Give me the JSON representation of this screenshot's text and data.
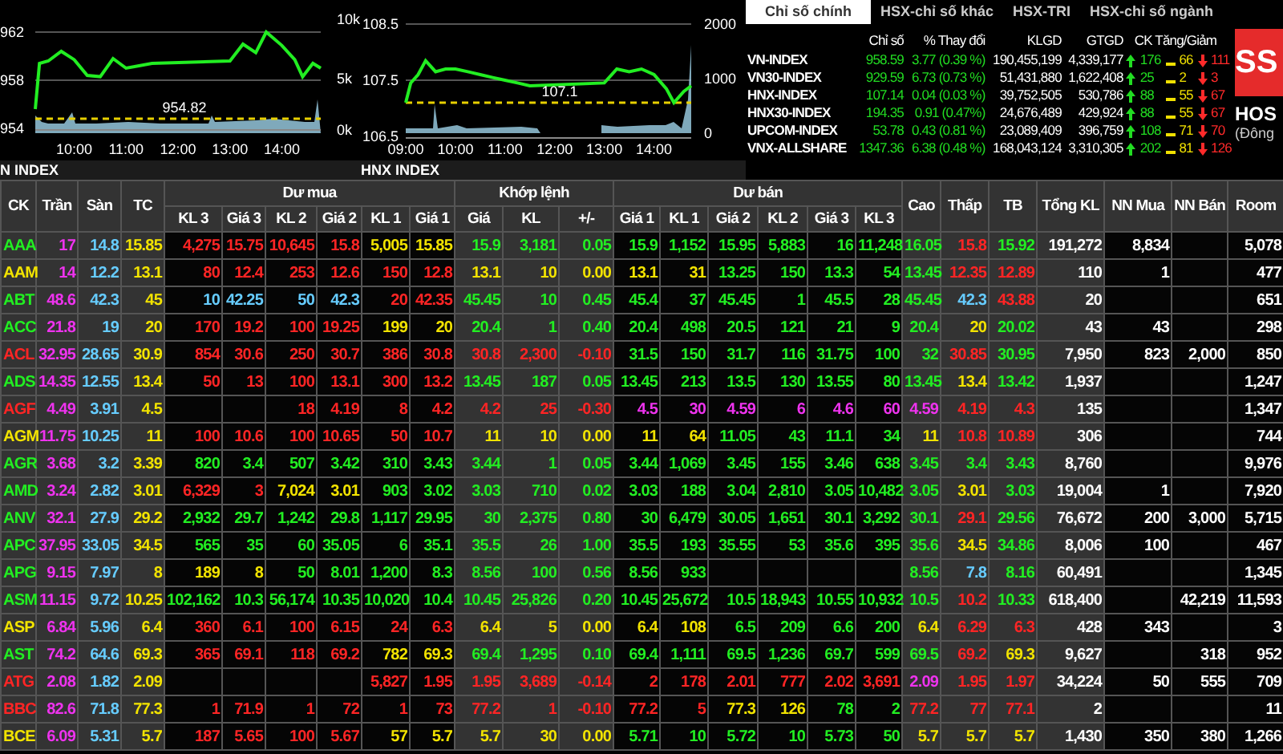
{
  "charts": [
    {
      "label": "N INDEX",
      "volume_ticks": [
        "10k",
        "5k",
        "0k"
      ],
      "reference": "954.82",
      "chart_data": {
        "type": "line",
        "x": [
          9.25,
          9.33,
          9.5,
          9.75,
          10,
          10.25,
          10.5,
          10.75,
          11,
          11.25,
          11.5,
          13,
          13.25,
          13.5,
          13.7,
          14,
          14.25,
          14.4,
          14.6,
          14.75
        ],
        "series": [
          {
            "color": "#22ee22",
            "values": [
              955.6,
              959.4,
              959.6,
              960.4,
              959.7,
              958.4,
              958.3,
              959.8,
              959.0,
              959.2,
              959.4,
              959.6,
              961.0,
              960.3,
              962.0,
              960.9,
              959.7,
              958.3,
              959.4,
              959.0
            ]
          }
        ],
        "xlim": [
          9.25,
          14.75
        ],
        "ylim": [
          954,
          962
        ],
        "xticks": [
          {
            "value": 10,
            "label": "10:00"
          },
          {
            "value": 11,
            "label": "11:00"
          },
          {
            "value": 12,
            "label": "12:00"
          },
          {
            "value": 13,
            "label": "13:00"
          },
          {
            "value": 14,
            "label": "14:00"
          }
        ],
        "yticks": [
          962,
          958,
          954
        ]
      }
    },
    {
      "label": "HNX INDEX",
      "volume_ticks": [
        "2000",
        "1000",
        "0"
      ],
      "reference": "107.1",
      "chart_data": {
        "type": "line",
        "x": [
          9,
          9.1,
          9.25,
          9.4,
          9.6,
          9.8,
          10,
          10.25,
          10.5,
          10.75,
          11,
          11.25,
          11.5,
          13,
          13.25,
          13.5,
          13.75,
          14,
          14.25,
          14.4,
          14.6,
          14.75
        ],
        "series": [
          {
            "color": "#22ee22",
            "values": [
              107.1,
              107.45,
              107.6,
              107.85,
              107.65,
              107.7,
              107.7,
              107.65,
              107.6,
              107.55,
              107.5,
              107.45,
              107.4,
              107.45,
              107.7,
              107.65,
              107.7,
              107.6,
              107.35,
              107.1,
              107.3,
              107.4
            ]
          }
        ],
        "xlim": [
          9,
          14.75
        ],
        "ylim": [
          106.5,
          108.5
        ],
        "xticks": [
          {
            "value": 9,
            "label": "09:00"
          },
          {
            "value": 10,
            "label": "10:00"
          },
          {
            "value": 11,
            "label": "11:00"
          },
          {
            "value": 12,
            "label": "12:00"
          },
          {
            "value": 13,
            "label": "13:00"
          },
          {
            "value": 14,
            "label": "14:00"
          }
        ],
        "yticks": [
          {
            "value": 108.5,
            "label": "108.5"
          },
          {
            "value": 107.5,
            "label": "107.5"
          },
          {
            "value": 106.5,
            "label": "106.5"
          }
        ]
      }
    }
  ],
  "index_panel": {
    "tabs": [
      {
        "label": "Chỉ số chính",
        "selected": true
      },
      {
        "label": "HSX-chỉ số khác",
        "selected": false
      },
      {
        "label": "HSX-TRI",
        "selected": false
      },
      {
        "label": "HSX-chỉ số ngành",
        "selected": false
      }
    ],
    "columns": [
      "Chỉ số",
      "% Thay đổi",
      "KLGD",
      "GTGD",
      "CK Tăng/Giảm"
    ],
    "rows": [
      {
        "name": "VN-INDEX",
        "value": "958.59",
        "change": "3.77 (0.39 %)",
        "klgd": "190,455,199",
        "gtgd": "4,339,177",
        "up": "176",
        "flat": "66",
        "down": "111"
      },
      {
        "name": "VN30-INDEX",
        "value": "929.59",
        "change": "6.73 (0.73 %)",
        "klgd": "51,431,880",
        "gtgd": "1,622,408",
        "up": "25",
        "flat": "2",
        "down": "3"
      },
      {
        "name": "HNX-INDEX",
        "value": "107.14",
        "change": "0.04 (0.03 %)",
        "klgd": "39,752,505",
        "gtgd": "530,786",
        "up": "88",
        "flat": "55",
        "down": "67"
      },
      {
        "name": "HNX30-INDEX",
        "value": "194.35",
        "change": "0.91 (0.47%)",
        "klgd": "24,676,489",
        "gtgd": "429,924",
        "up": "88",
        "flat": "55",
        "down": "67"
      },
      {
        "name": "UPCOM-INDEX",
        "value": "53.78",
        "change": "0.43 (0.81 %)",
        "klgd": "23,089,409",
        "gtgd": "396,759",
        "up": "108",
        "flat": "71",
        "down": "70"
      },
      {
        "name": "VNX-ALLSHARE",
        "value": "1347.36",
        "change": "6.38 (0.48 %)",
        "klgd": "168,043,124",
        "gtgd": "3,310,305",
        "up": "202",
        "flat": "81",
        "down": "126"
      }
    ]
  },
  "logo": {
    "mark": "SS",
    "title": "HOS",
    "subtitle": "(Đông"
  },
  "table": {
    "header": [
      {
        "label": "CK"
      },
      {
        "label": "Trần"
      },
      {
        "label": "Sàn"
      },
      {
        "label": "TC"
      },
      {
        "label": "Dư mua",
        "columns": [
          "KL 3",
          "Giá 3",
          "KL 2",
          "Giá 2",
          "KL 1",
          "Giá 1"
        ]
      },
      {
        "label": "Khớp lệnh",
        "columns": [
          "Giá",
          "KL",
          "+/-"
        ]
      },
      {
        "label": "Dư bán",
        "columns": [
          "Giá 1",
          "KL 1",
          "Giá 2",
          "KL 2",
          "Giá 3",
          "KL 3"
        ]
      },
      {
        "label": "Cao"
      },
      {
        "label": "Thấp"
      },
      {
        "label": "TB"
      },
      {
        "label": "Tổng KL"
      },
      {
        "label": "NN Mua"
      },
      {
        "label": "NN Bán"
      },
      {
        "label": "Room"
      }
    ],
    "rows": [
      [
        "AAA",
        "17",
        "14.8",
        "15.85",
        "4,275",
        "15.75",
        "10,645",
        "15.8",
        "5,005",
        "15.85",
        "15.9",
        "3,181",
        "0.05",
        "15.9",
        "1,152",
        "15.95",
        "5,883",
        "16",
        "11,248",
        "16.05",
        "15.8",
        "15.92",
        "191,272",
        "8,834",
        null,
        "5,078"
      ],
      [
        "AAM",
        "14",
        "12.2",
        "13.1",
        "80",
        "12.4",
        "253",
        "12.6",
        "150",
        "12.8",
        "13.1",
        "10",
        "0.00",
        "13.1",
        "31",
        "13.25",
        "150",
        "13.3",
        "54",
        "13.45",
        "12.35",
        "12.89",
        "110",
        "1",
        null,
        "477"
      ],
      [
        "ABT",
        "48.6",
        "42.3",
        "45",
        "10",
        "42.25",
        "50",
        "42.3",
        "20",
        "42.35",
        "45.45",
        "10",
        "0.45",
        "45.4",
        "37",
        "45.45",
        "1",
        "45.5",
        "28",
        "45.45",
        "42.3",
        "43.88",
        "20",
        null,
        null,
        "651"
      ],
      [
        "ACC",
        "21.8",
        "19",
        "20",
        "170",
        "19.2",
        "100",
        "19.25",
        "199",
        "20",
        "20.4",
        "1",
        "0.40",
        "20.4",
        "498",
        "20.5",
        "121",
        "21",
        "9",
        "20.4",
        "20",
        "20.02",
        "43",
        "43",
        null,
        "298"
      ],
      [
        "ACL",
        "32.95",
        "28.65",
        "30.9",
        "854",
        "30.6",
        "250",
        "30.7",
        "386",
        "30.8",
        "30.8",
        "2,300",
        "-0.10",
        "31.5",
        "150",
        "31.7",
        "116",
        "31.75",
        "100",
        "32",
        "30.85",
        "30.95",
        "7,950",
        "823",
        "2,000",
        "850"
      ],
      [
        "ADS",
        "14.35",
        "12.55",
        "13.4",
        "50",
        "13",
        "100",
        "13.1",
        "300",
        "13.2",
        "13.45",
        "187",
        "0.05",
        "13.45",
        "213",
        "13.5",
        "130",
        "13.55",
        "80",
        "13.45",
        "13.4",
        "13.42",
        "1,937",
        null,
        null,
        "1,247"
      ],
      [
        "AGF",
        "4.49",
        "3.91",
        "4.5",
        null,
        null,
        "18",
        "4.19",
        "8",
        "4.2",
        "4.2",
        "25",
        "-0.30",
        "4.5",
        "30",
        "4.59",
        "6",
        "4.6",
        "60",
        "4.59",
        "4.19",
        "4.3",
        "135",
        null,
        null,
        "1,347"
      ],
      [
        "AGM",
        "11.75",
        "10.25",
        "11",
        "100",
        "10.6",
        "100",
        "10.65",
        "50",
        "10.7",
        "11",
        "10",
        "0.00",
        "11",
        "64",
        "11.05",
        "43",
        "11.1",
        "34",
        "11",
        "10.8",
        "10.89",
        "306",
        null,
        null,
        "744"
      ],
      [
        "AGR",
        "3.68",
        "3.2",
        "3.39",
        "820",
        "3.4",
        "507",
        "3.42",
        "310",
        "3.43",
        "3.44",
        "1",
        "0.05",
        "3.44",
        "1,069",
        "3.45",
        "155",
        "3.46",
        "638",
        "3.45",
        "3.4",
        "3.43",
        "8,760",
        null,
        null,
        "9,976"
      ],
      [
        "AMD",
        "3.24",
        "2.82",
        "3.01",
        "6,329",
        "3",
        "7,024",
        "3.01",
        "903",
        "3.02",
        "3.03",
        "710",
        "0.02",
        "3.03",
        "188",
        "3.04",
        "2,810",
        "3.05",
        "10,482",
        "3.05",
        "3.01",
        "3.03",
        "19,004",
        "1",
        null,
        "7,920"
      ],
      [
        "ANV",
        "32.1",
        "27.9",
        "29.2",
        "2,932",
        "29.7",
        "1,242",
        "29.8",
        "1,117",
        "29.95",
        "30",
        "2,375",
        "0.80",
        "30",
        "6,479",
        "30.05",
        "1,651",
        "30.1",
        "3,292",
        "30.1",
        "29.1",
        "29.56",
        "76,672",
        "200",
        "3,000",
        "5,715"
      ],
      [
        "APC",
        "37.95",
        "33.05",
        "34.5",
        "565",
        "35",
        "60",
        "35.05",
        "6",
        "35.1",
        "35.5",
        "26",
        "1.00",
        "35.5",
        "193",
        "35.55",
        "53",
        "35.6",
        "395",
        "35.6",
        "34.5",
        "34.86",
        "8,006",
        "100",
        null,
        "467"
      ],
      [
        "APG",
        "9.15",
        "7.97",
        "8",
        "189",
        "8",
        "50",
        "8.01",
        "1,200",
        "8.3",
        "8.56",
        "100",
        "0.56",
        "8.56",
        "933",
        null,
        null,
        null,
        null,
        "8.56",
        "7.8",
        "8.16",
        "60,491",
        null,
        null,
        "1,345"
      ],
      [
        "ASM",
        "11.15",
        "9.72",
        "10.25",
        "102,162",
        "10.3",
        "56,174",
        "10.35",
        "10,020",
        "10.4",
        "10.45",
        "25,826",
        "0.20",
        "10.45",
        "25,672",
        "10.5",
        "18,943",
        "10.55",
        "10,932",
        "10.5",
        "10.2",
        "10.33",
        "618,400",
        null,
        "42,219",
        "11,593"
      ],
      [
        "ASP",
        "6.84",
        "5.96",
        "6.4",
        "360",
        "6.1",
        "100",
        "6.15",
        "24",
        "6.3",
        "6.4",
        "5",
        "0.00",
        "6.4",
        "108",
        "6.5",
        "209",
        "6.6",
        "200",
        "6.4",
        "6.29",
        "6.3",
        "428",
        "343",
        null,
        "3"
      ],
      [
        "AST",
        "74.2",
        "64.6",
        "69.3",
        "365",
        "69.1",
        "118",
        "69.2",
        "782",
        "69.3",
        "69.4",
        "1,295",
        "0.10",
        "69.4",
        "1,111",
        "69.5",
        "1,236",
        "69.7",
        "599",
        "69.5",
        "69.2",
        "69.3",
        "9,627",
        null,
        "318",
        "952"
      ],
      [
        "ATG",
        "2.08",
        "1.82",
        "2.09",
        null,
        null,
        null,
        null,
        "5,827",
        "1.95",
        "1.95",
        "3,689",
        "-0.14",
        "2",
        "178",
        "2.01",
        "777",
        "2.02",
        "3,691",
        "2.09",
        "1.95",
        "1.97",
        "34,224",
        "50",
        "555",
        "709"
      ],
      [
        "BBC",
        "82.6",
        "71.8",
        "77.3",
        "1",
        "71.9",
        "1",
        "72",
        "1",
        "73",
        "77.2",
        "1",
        "-0.10",
        "77.2",
        "5",
        "77.3",
        "126",
        "78",
        "2",
        "77.2",
        "77",
        "77.1",
        "2",
        null,
        null,
        "11"
      ],
      [
        "BCE",
        "6.09",
        "5.31",
        "5.7",
        "187",
        "5.65",
        "100",
        "5.67",
        "57",
        "5.7",
        "5.7",
        "30",
        "0.00",
        "5.71",
        "10",
        "5.72",
        "10",
        "5.73",
        "50",
        "5.7",
        "5.7",
        "5.7",
        "1,430",
        "350",
        "380",
        "1,266"
      ]
    ]
  }
}
